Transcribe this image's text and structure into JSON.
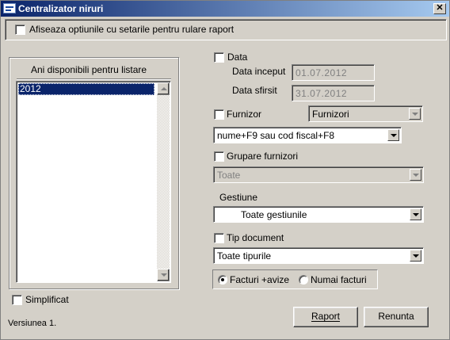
{
  "window": {
    "title": "Centralizator niruri",
    "close_glyph": "✕"
  },
  "options_checkbox": {
    "label": "Afiseaza optiunile cu setarile pentru rulare raport",
    "checked": false
  },
  "years_panel": {
    "title": "Ani disponibili pentru listare",
    "items": [
      "2012"
    ],
    "selected": "2012"
  },
  "simplificat": {
    "label": "Simplificat",
    "checked": false
  },
  "version": "Versiunea 1.",
  "data_filter": {
    "label": "Data",
    "checked": false,
    "start_label": "Data inceput",
    "start_value": "01.07.2012",
    "end_label": "Data sfirsit",
    "end_value": "31.07.2012"
  },
  "furnizor": {
    "label": "Furnizor",
    "checked": false,
    "combo_value": "Furnizori",
    "search_value": "nume+F9 sau cod fiscal+F8"
  },
  "grupare": {
    "label": "Grupare furnizori",
    "checked": false,
    "value": "Toate"
  },
  "gestiune": {
    "label": "Gestiune",
    "value": "Toate gestiunile"
  },
  "tip_document": {
    "label": "Tip document",
    "checked": false,
    "value": "Toate tipurile"
  },
  "radio_options": [
    {
      "label": "Facturi +avize",
      "selected": true
    },
    {
      "label": "Numai facturi",
      "selected": false
    }
  ],
  "buttons": {
    "raport": "Raport",
    "renunta": "Renunta"
  },
  "colors": {
    "title_start": "#0a246a",
    "title_end": "#a6caf0",
    "selection": "#0a246a",
    "face": "#d4d0c8"
  }
}
